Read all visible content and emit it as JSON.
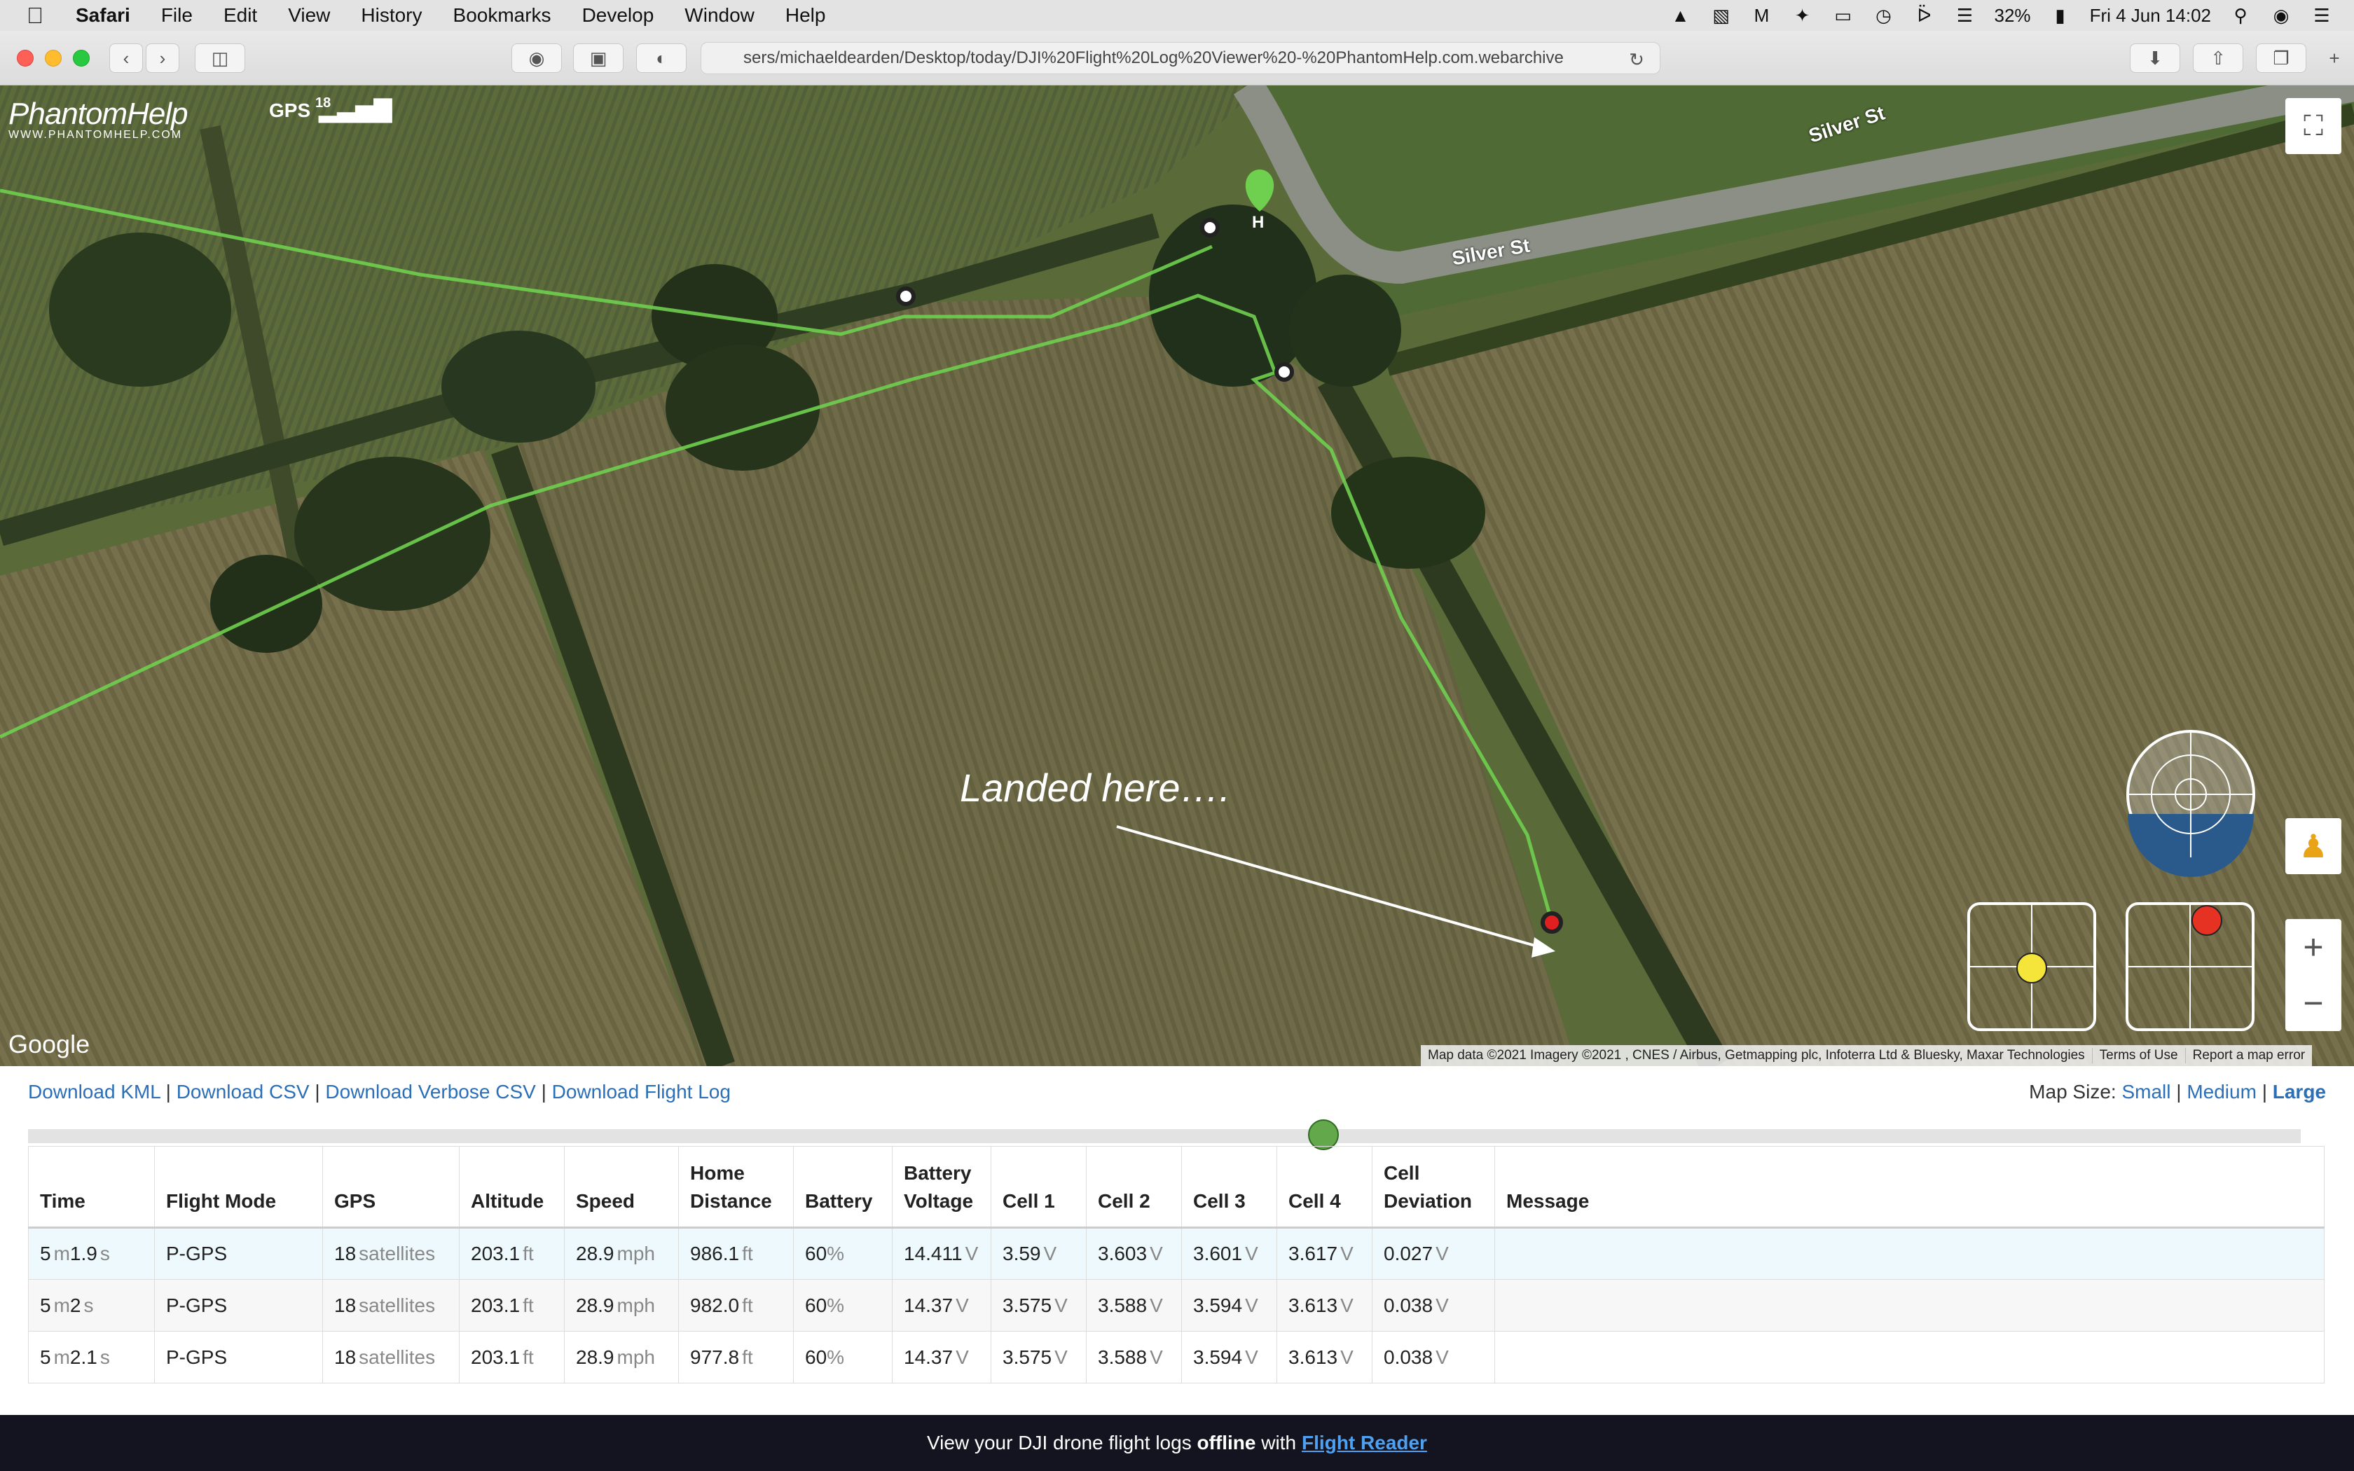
{
  "menubar": {
    "app": "Safari",
    "items": [
      "File",
      "Edit",
      "View",
      "History",
      "Bookmarks",
      "Develop",
      "Window",
      "Help"
    ],
    "battery": "32%",
    "datetime": "Fri 4 Jun  14:02"
  },
  "browser": {
    "url": "sers/michaeldearden/Desktop/today/DJI%20Flight%20Log%20Viewer%20-%20PhantomHelp.com.webarchive"
  },
  "map": {
    "logo_name": "PhantomHelp",
    "logo_sub": "WWW.PHANTOMHELP.COM",
    "gps_label": "GPS",
    "gps_count": "18",
    "road_label_1": "Silver St",
    "road_label_2": "Silver St",
    "home_marker": "H",
    "annotation": "Landed here….",
    "google": "Google",
    "attribution": [
      "Map data ©2021 Imagery ©2021 , CNES / Airbus, Getmapping plc, Infoterra Ltd & Bluesky, Maxar Technologies",
      "Terms of Use",
      "Report a map error"
    ],
    "zoom_in": "+",
    "zoom_out": "−"
  },
  "links": {
    "kml": "Download KML",
    "csv": "Download CSV",
    "verbose_csv": "Download Verbose CSV",
    "flight_log": "Download Flight Log",
    "sep": "|"
  },
  "mapsize": {
    "label": "Map Size:",
    "small": "Small",
    "medium": "Medium",
    "large": "Large"
  },
  "timeline": {
    "position": 0.57
  },
  "table": {
    "headers": [
      "Time",
      "Flight Mode",
      "GPS",
      "Altitude",
      "Speed",
      "Home Distance",
      "Battery",
      "Battery Voltage",
      "Cell 1",
      "Cell 2",
      "Cell 3",
      "Cell 4",
      "Cell Deviation",
      "Message"
    ],
    "rows": [
      {
        "time_m": "5",
        "time_s": "1.9",
        "mode": "P-GPS",
        "gps": "18",
        "alt": "203.1",
        "speed": "28.9",
        "dist": "986.1",
        "batt": "60",
        "volt": "14.411",
        "c1": "3.59",
        "c2": "3.603",
        "c3": "3.601",
        "c4": "3.617",
        "dev": "0.027",
        "msg": ""
      },
      {
        "time_m": "5",
        "time_s": "2",
        "mode": "P-GPS",
        "gps": "18",
        "alt": "203.1",
        "speed": "28.9",
        "dist": "982.0",
        "batt": "60",
        "volt": "14.37",
        "c1": "3.575",
        "c2": "3.588",
        "c3": "3.594",
        "c4": "3.613",
        "dev": "0.038",
        "msg": ""
      },
      {
        "time_m": "5",
        "time_s": "2.1",
        "mode": "P-GPS",
        "gps": "18",
        "alt": "203.1",
        "speed": "28.9",
        "dist": "977.8",
        "batt": "60",
        "volt": "14.37",
        "c1": "3.575",
        "c2": "3.588",
        "c3": "3.594",
        "c4": "3.613",
        "dev": "0.038",
        "msg": ""
      }
    ],
    "units": {
      "m": "m",
      "s": "s",
      "sat": "satellites",
      "ft": "ft",
      "mph": "mph",
      "pct": "%",
      "v": "V"
    }
  },
  "footer": {
    "text_1": "View your DJI drone flight logs",
    "offline": "offline",
    "text_2": "with",
    "link": "Flight Reader"
  },
  "colors": {
    "flight_path": "#6fcf4f",
    "link": "#2a6fb7",
    "timeline_thumb": "#63a84a",
    "footer_bg": "#141421"
  }
}
